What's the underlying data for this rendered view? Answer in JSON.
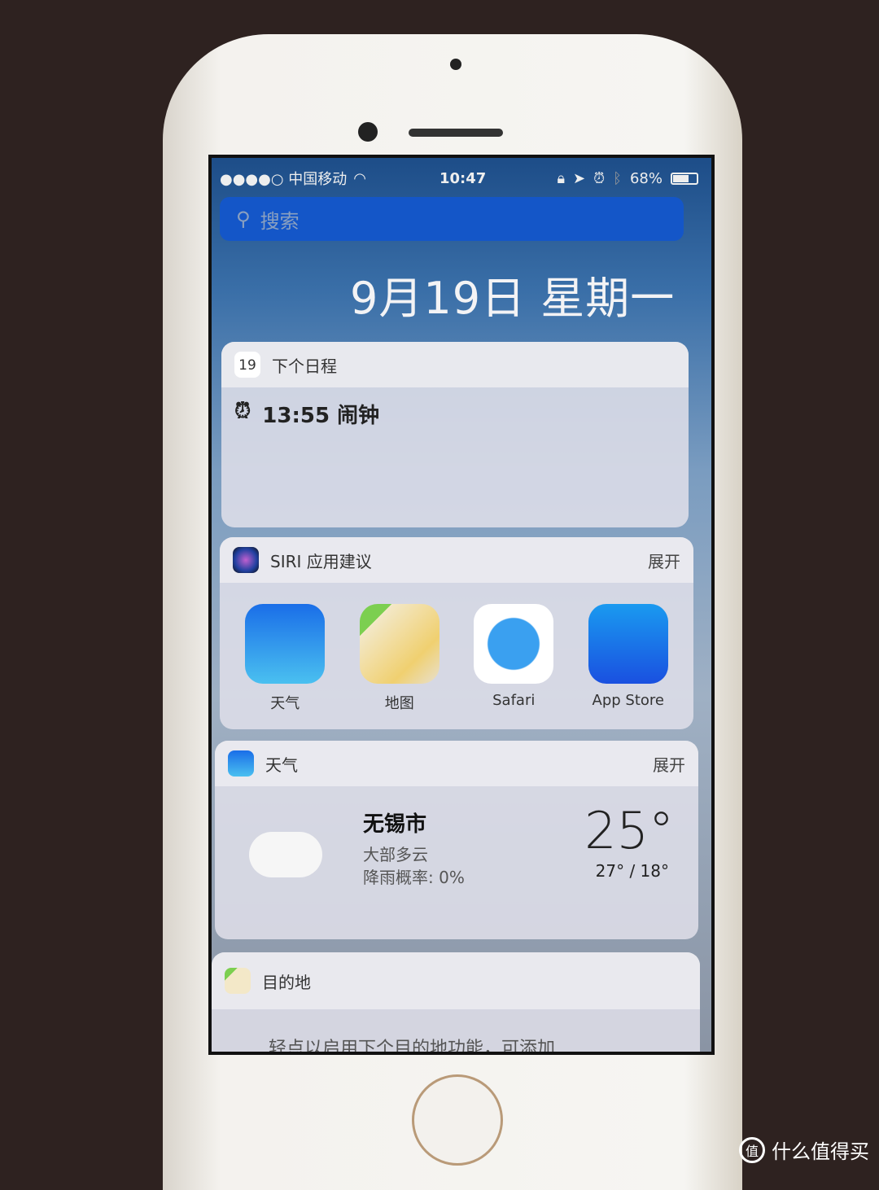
{
  "status_bar": {
    "carrier": "●●●●○ 中国移动",
    "time": "10:47",
    "battery": "68%",
    "battery_level": 0.68
  },
  "search": {
    "placeholder": "搜索"
  },
  "date": "9月19日 星期一",
  "calendar_widget": {
    "icon_day": "19",
    "title": "下个日程",
    "event": "13:55 闹钟"
  },
  "siri_widget": {
    "title": "SIRI 应用建议",
    "expand": "展开",
    "apps": [
      {
        "label": "天气"
      },
      {
        "label": "地图"
      },
      {
        "label": "Safari"
      },
      {
        "label": "App Store"
      }
    ]
  },
  "weather_widget": {
    "title": "天气",
    "expand": "展开",
    "city": "无锡市",
    "condition": "大部多云",
    "rain": "降雨概率: 0%",
    "temp": "25°",
    "range": "27° / 18°"
  },
  "destination_widget": {
    "title": "目的地",
    "body": "轻点以启用下个目的地功能，可添加"
  },
  "watermark": "什么值得买"
}
